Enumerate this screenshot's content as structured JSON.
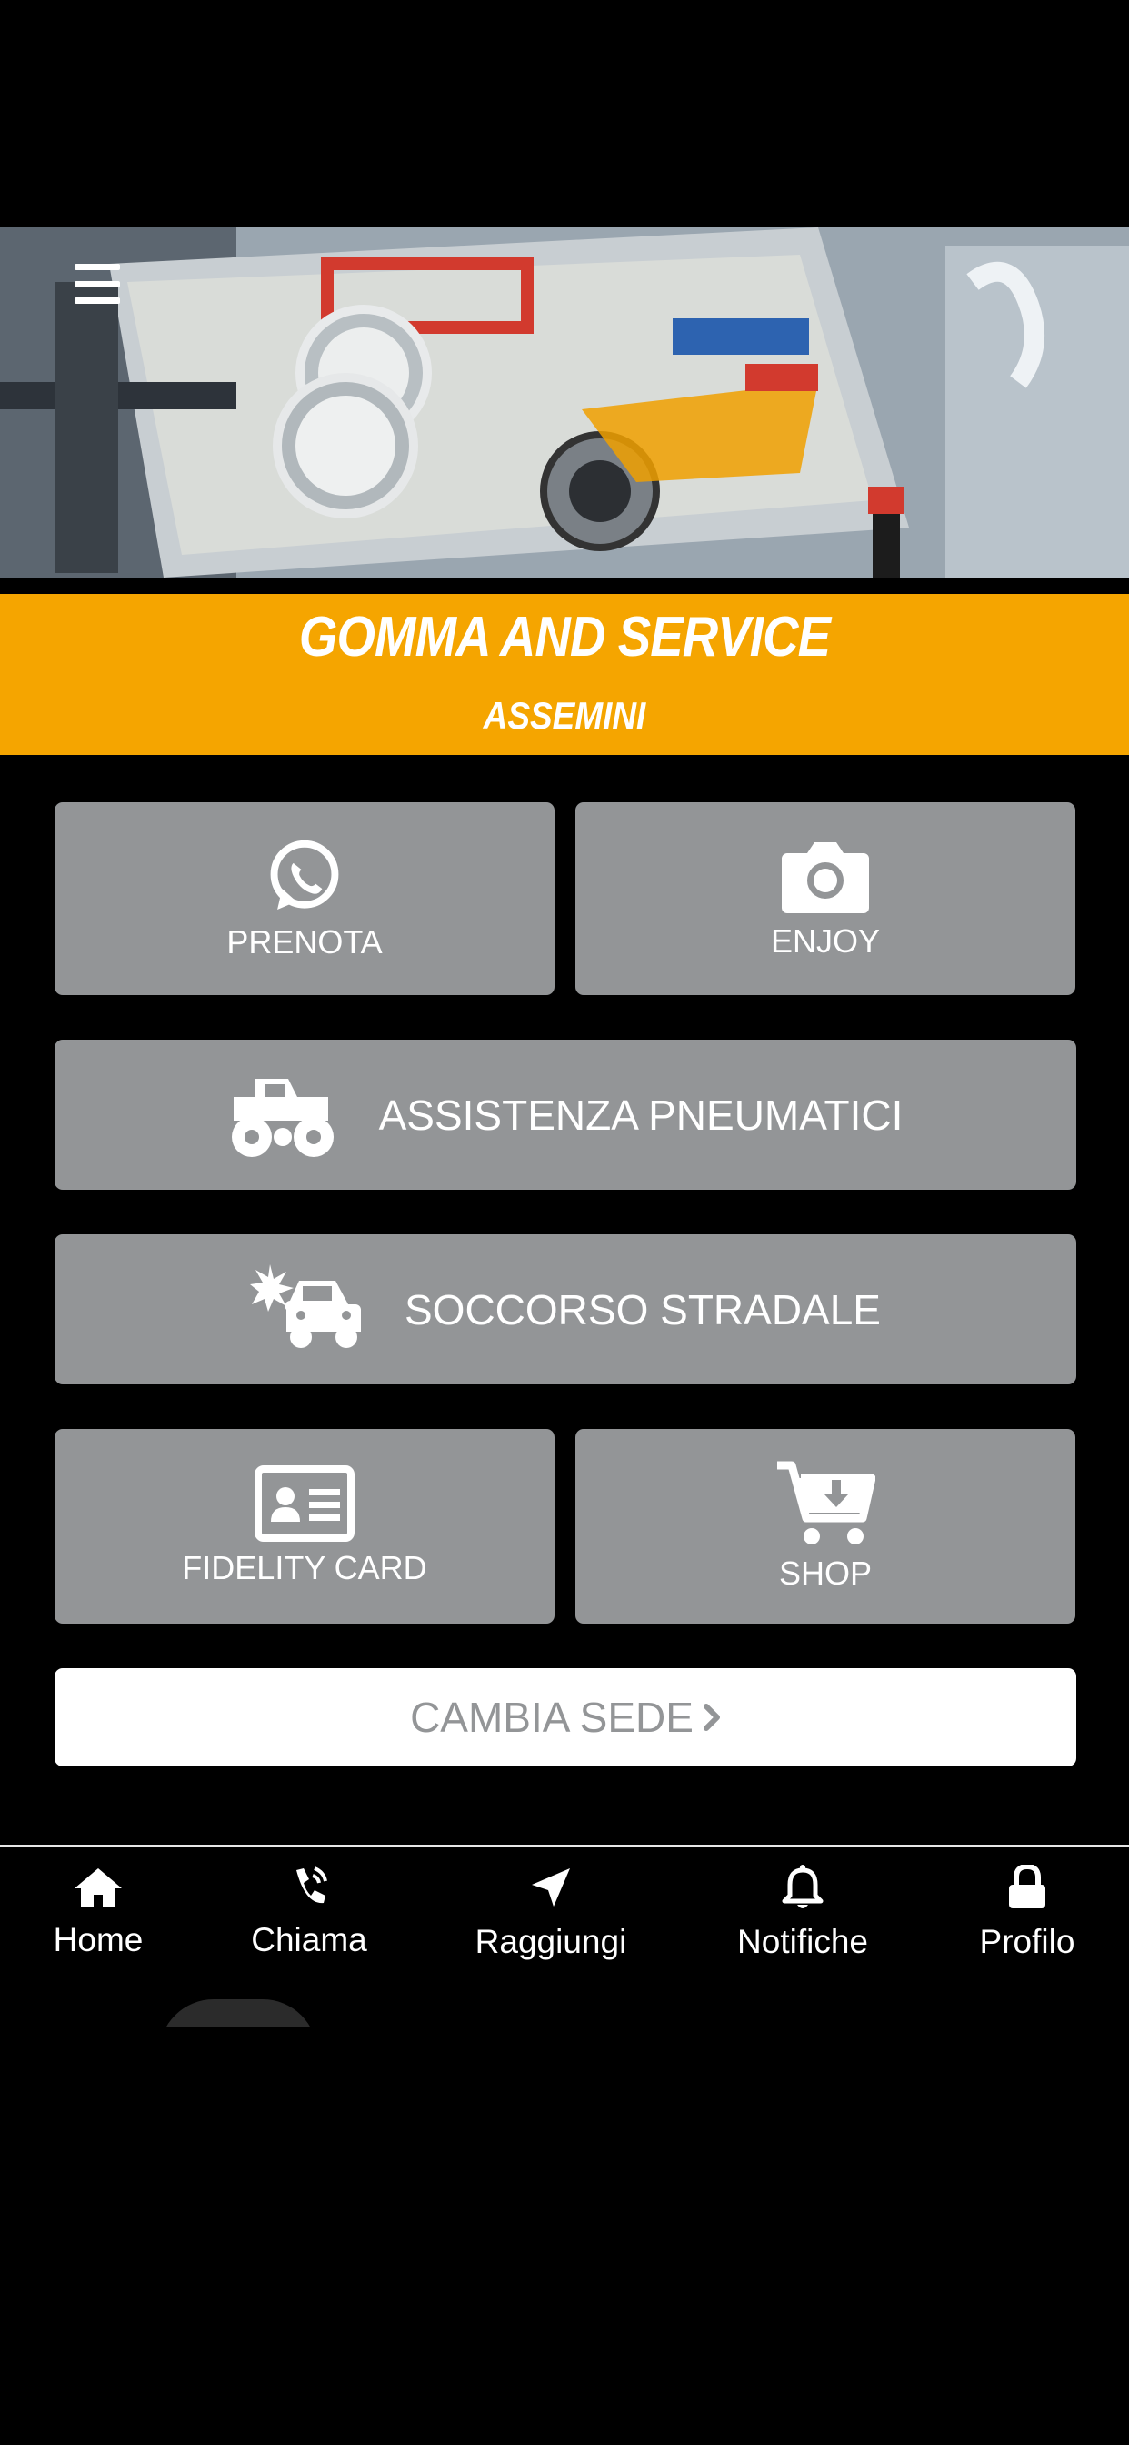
{
  "brand": {
    "title": "GOMMA AND SERVICE",
    "subtitle": "ASSEMINI",
    "accent_color": "#f5a500"
  },
  "header": {
    "menu_icon": "hamburger-menu-icon",
    "hero_image": "tire service equipment photo"
  },
  "tiles": {
    "prenota": {
      "label": "PRENOTA",
      "icon": "whatsapp-icon"
    },
    "enjoy": {
      "label": "ENJOY",
      "icon": "camera-icon"
    },
    "assistenza": {
      "label": "ASSISTENZA PNEUMATICI",
      "icon": "monster-truck-icon"
    },
    "soccorso": {
      "label": "SOCCORSO STRADALE",
      "icon": "car-crash-icon"
    },
    "fidelity": {
      "label": "FIDELITY CARD",
      "icon": "id-card-icon"
    },
    "shop": {
      "label": "SHOP",
      "icon": "cart-download-icon"
    }
  },
  "cambia_sede": {
    "label": "CAMBIA SEDE",
    "icon": "chevron-right-icon"
  },
  "bottom_nav": [
    {
      "label": "Home",
      "icon": "home-icon"
    },
    {
      "label": "Chiama",
      "icon": "phone-icon"
    },
    {
      "label": "Raggiungi",
      "icon": "location-arrow-icon"
    },
    {
      "label": "Notifiche",
      "icon": "bell-icon"
    },
    {
      "label": "Profilo",
      "icon": "lock-icon"
    }
  ],
  "colors": {
    "background": "#000000",
    "tile": "#939597",
    "button_text": "#939597"
  }
}
